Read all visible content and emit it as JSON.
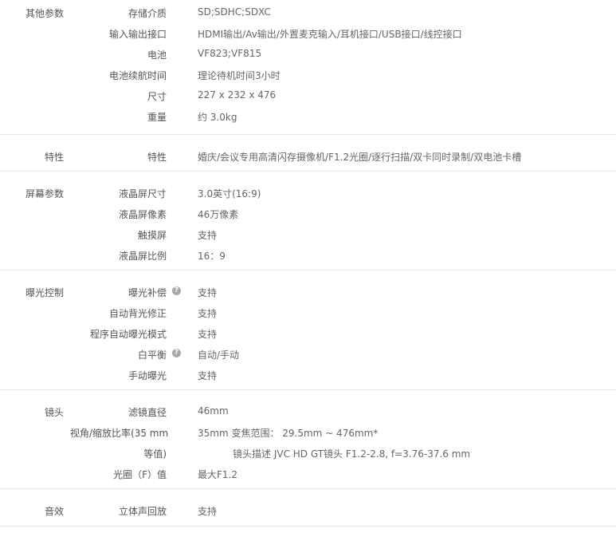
{
  "sections": [
    {
      "category": "其他参数",
      "rows": [
        {
          "label": "存储介质",
          "value": "SD;SDHC;SDXC"
        },
        {
          "label": "输入输出接口",
          "value": "HDMI输出/Av输出/外置麦克输入/耳机接口/USB接口/线控接口"
        },
        {
          "label": "电池",
          "value": "VF823;VF815"
        },
        {
          "label": "电池续航时间",
          "value": "理论待机时间3小时"
        },
        {
          "label": "尺寸",
          "value": "227 x 232 x 476"
        },
        {
          "label": "重量",
          "value": "约 3.0kg"
        }
      ]
    },
    {
      "category": "特性",
      "rows": [
        {
          "label": "特性",
          "value": "婚庆/会议专用高清闪存摄像机/F1.2光圈/逐行扫描/双卡同时录制/双电池卡槽"
        }
      ]
    },
    {
      "category": "屏幕参数",
      "rows": [
        {
          "label": "液晶屏尺寸",
          "value": "3.0英寸(16:9)"
        },
        {
          "label": "液晶屏像素",
          "value": "46万像素"
        },
        {
          "label": "触摸屏",
          "value": "支持"
        },
        {
          "label": "液晶屏比例",
          "value": "16：9"
        }
      ]
    },
    {
      "category": "曝光控制",
      "rows": [
        {
          "label": "曝光补偿",
          "value": "支持",
          "help": "?"
        },
        {
          "label": "自动背光修正",
          "value": "支持"
        },
        {
          "label": "程序自动曝光模式",
          "value": "支持"
        },
        {
          "label": "白平衡",
          "value": "自动/手动",
          "help": "?"
        },
        {
          "label": "手动曝光",
          "value": "支持"
        }
      ]
    },
    {
      "category": "镜头",
      "rows": [
        {
          "label": "滤镜直径",
          "value": "46mm"
        },
        {
          "label": "视角/缩放比率(35 mm",
          "value": "35mm 变焦范围： 29.5mm ~ 476mm*"
        },
        {
          "label": "等值)",
          "value": "镜头描述 JVC HD GT镜头 F1.2-2.8, f=3.76-37.6 mm",
          "indent": true
        },
        {
          "label": "光圈（F）值",
          "value": "最大F1.2"
        }
      ]
    },
    {
      "category": "音效",
      "rows": [
        {
          "label": "立体声回放",
          "value": "支持"
        }
      ]
    }
  ]
}
